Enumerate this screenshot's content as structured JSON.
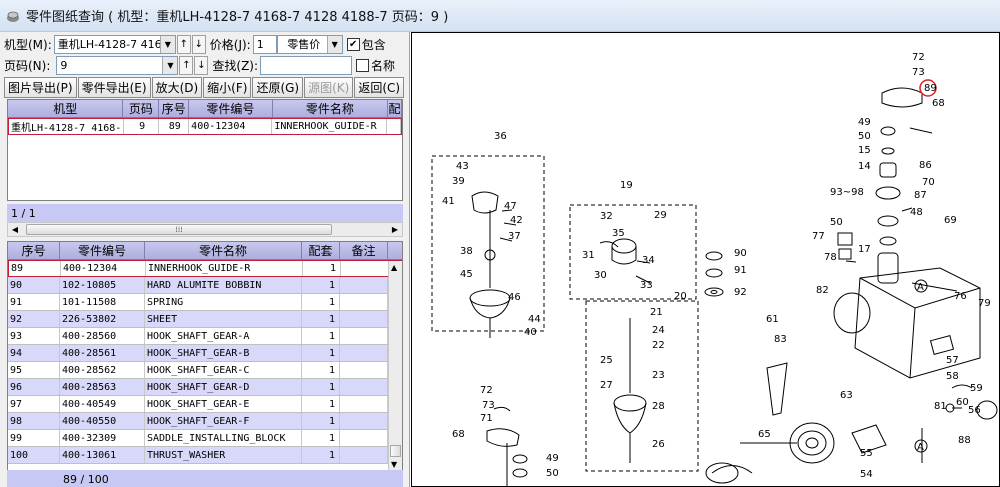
{
  "window": {
    "title": "零件图纸查询 ( 机型：重机LH-4128-7 4168-7 4128 4188-7 页码：9 )"
  },
  "filters": {
    "model_label": "机型(M):",
    "model_value": "重机LH-4128-7 4168-",
    "price_label": "价格(J):",
    "price_value": "1",
    "price_type": "零售价",
    "include_label": "包含",
    "include_checked": "✔",
    "page_label": "页码(N):",
    "page_value": "9",
    "search_label": "查找(Z):",
    "search_value": "",
    "name_label": "名称"
  },
  "toolbar": {
    "export_image": "图片导出(P)",
    "export_parts": "零件导出(E)",
    "zoom_in": "放大(D)",
    "zoom_out": "缩小(F)",
    "restore": "还原(G)",
    "source_image": "源图(K)",
    "back": "返回(C)"
  },
  "top_grid": {
    "headers": [
      "机型",
      "页码",
      "序号",
      "零件编号",
      "零件名称",
      "配"
    ],
    "rows": [
      [
        "重机LH-4128-7 4168-",
        "9",
        "89",
        "400-12304",
        "INNERHOOK_GUIDE-R",
        ""
      ]
    ],
    "status": "1 / 1"
  },
  "bottom_grid": {
    "headers": [
      "序号",
      "零件编号",
      "零件名称",
      "配套",
      "备注"
    ],
    "rows": [
      [
        "89",
        "400-12304",
        "INNERHOOK_GUIDE-R",
        "1",
        ""
      ],
      [
        "90",
        "102-10805",
        "HARD ALUMITE BOBBIN",
        "1",
        ""
      ],
      [
        "91",
        "101-11508",
        "SPRING",
        "1",
        ""
      ],
      [
        "92",
        "226-53802",
        "SHEET",
        "1",
        ""
      ],
      [
        "93",
        "400-28560",
        "HOOK_SHAFT_GEAR-A",
        "1",
        ""
      ],
      [
        "94",
        "400-28561",
        "HOOK_SHAFT_GEAR-B",
        "1",
        ""
      ],
      [
        "95",
        "400-28562",
        "HOOK_SHAFT_GEAR-C",
        "1",
        ""
      ],
      [
        "96",
        "400-28563",
        "HOOK_SHAFT_GEAR-D",
        "1",
        ""
      ],
      [
        "97",
        "400-40549",
        "HOOK_SHAFT_GEAR-E",
        "1",
        ""
      ],
      [
        "98",
        "400-40550",
        "HOOK_SHAFT_GEAR-F",
        "1",
        ""
      ],
      [
        "99",
        "400-32309",
        "SADDLE_INSTALLING_BLOCK",
        "1",
        ""
      ],
      [
        "100",
        "400-13061",
        "THRUST_WASHER",
        "1",
        ""
      ]
    ],
    "status": "89 / 100"
  },
  "diagram": {
    "labels": [
      "72",
      "73",
      "89",
      "68",
      "49",
      "50",
      "15",
      "86",
      "70",
      "87",
      "48",
      "93~98",
      "14",
      "69",
      "50",
      "77",
      "17",
      "78",
      "76",
      "82",
      "61",
      "83",
      "79",
      "57",
      "58",
      "59",
      "60",
      "81",
      "88",
      "63",
      "65",
      "55",
      "54",
      "56",
      "36",
      "43",
      "39",
      "41",
      "47",
      "42",
      "37",
      "38",
      "45",
      "46",
      "44",
      "40",
      "19",
      "32",
      "35",
      "29",
      "31",
      "34",
      "30",
      "33",
      "20",
      "90",
      "91",
      "92",
      "21",
      "24",
      "22",
      "25",
      "23",
      "27",
      "28",
      "26",
      "72",
      "73",
      "71",
      "68",
      "49",
      "50",
      "A",
      "A"
    ]
  }
}
